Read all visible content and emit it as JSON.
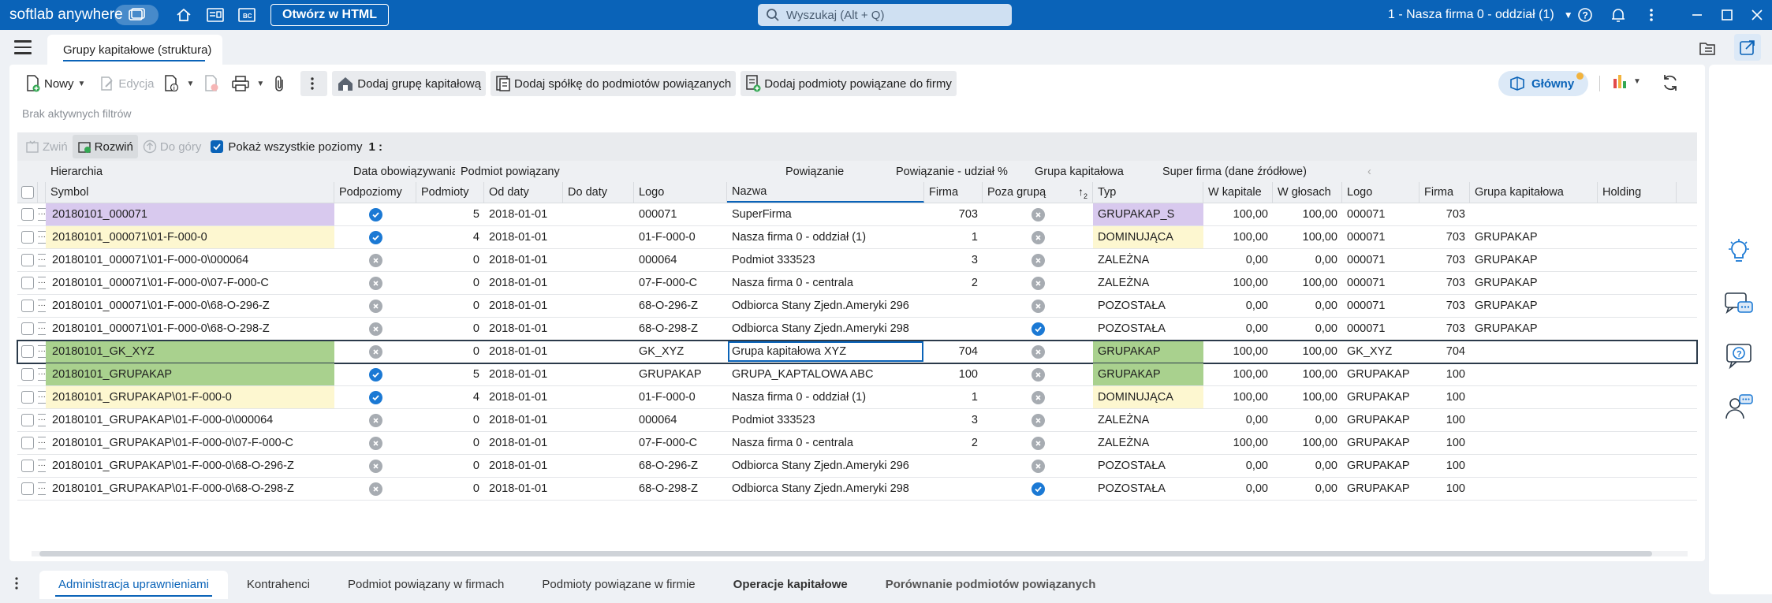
{
  "titlebar": {
    "brand": "softlab anywhere",
    "open_html": "Otwórz w HTML",
    "search_placeholder": "Wyszukaj (Alt + Q)",
    "company": "1 - Nasza firma 0 - oddział (1)"
  },
  "tab": {
    "title": "Grupy kapitałowe (struktura)"
  },
  "toolbar": {
    "new": "Nowy",
    "edit": "Edycja",
    "add_group": "Dodaj grupę kapitałową",
    "add_company": "Dodaj spółkę do podmiotów powiązanych",
    "add_related": "Dodaj podmioty powiązane do firmy",
    "view": "Główny"
  },
  "filters": "Brak aktywnych filtrów",
  "subtoolbar": {
    "collapse": "Zwiń",
    "expand": "Rozwiń",
    "up": "Do góry",
    "show_all": "Pokaż wszystkie poziomy",
    "level": "1 :"
  },
  "grid": {
    "groups": {
      "hierarchy": "Hierarchia",
      "validity": "Data obowiązywania",
      "related": "Podmiot powiązany",
      "link": "Powiązanie",
      "share": "Powiązanie - udział %",
      "capital_group": "Grupa kapitałowa",
      "super": "Super firma (dane źródłowe)"
    },
    "columns": {
      "symbol": "Symbol",
      "sublevels": "Podpoziomy",
      "entities": "Podmioty",
      "from": "Od daty",
      "to": "Do daty",
      "logo": "Logo",
      "name": "Nazwa",
      "firm": "Firma",
      "outside": "Poza grupą",
      "type": "Typ",
      "capital": "W kapitale",
      "votes": "W głosach",
      "g_logo": "Logo",
      "g_firm": "Firma",
      "s_group": "Grupa kapitałowa",
      "s_holding": "Holding"
    },
    "rows": [
      {
        "symbol": "20180101_000071",
        "sub": "ok",
        "ent": "5",
        "from": "2018-01-01",
        "logo": "000071",
        "name": "SuperFirma",
        "firm": "703",
        "out": "x",
        "type": "GRUPAKAP_S",
        "cap": "100,00",
        "votes": "100,00",
        "glogo": "000071",
        "gfirm": "703",
        "sgroup": "",
        "sym_color": "#d8c9ee",
        "type_color": "#d8c9ee"
      },
      {
        "symbol": "20180101_000071\\01-F-000-0",
        "sub": "ok",
        "ent": "4",
        "from": "2018-01-01",
        "logo": "01-F-000-0",
        "name": "Nasza firma 0 - oddział (1)",
        "firm": "1",
        "out": "x",
        "type": "DOMINUJĄCA",
        "cap": "100,00",
        "votes": "100,00",
        "glogo": "000071",
        "gfirm": "703",
        "sgroup": "GRUPAKAP",
        "sym_color": "#fdf7d0",
        "type_color": "#fdf7d0"
      },
      {
        "symbol": "20180101_000071\\01-F-000-0\\000064",
        "sub": "x",
        "ent": "0",
        "from": "2018-01-01",
        "logo": "000064",
        "name": "Podmiot 333523",
        "firm": "3",
        "out": "x",
        "type": "ZALEŻNA",
        "cap": "0,00",
        "votes": "0,00",
        "glogo": "000071",
        "gfirm": "703",
        "sgroup": "GRUPAKAP",
        "sym_color": "",
        "type_color": ""
      },
      {
        "symbol": "20180101_000071\\01-F-000-0\\07-F-000-C",
        "sub": "x",
        "ent": "0",
        "from": "2018-01-01",
        "logo": "07-F-000-C",
        "name": "Nasza firma 0 - centrala",
        "firm": "2",
        "out": "x",
        "type": "ZALEŻNA",
        "cap": "100,00",
        "votes": "100,00",
        "glogo": "000071",
        "gfirm": "703",
        "sgroup": "GRUPAKAP",
        "sym_color": "",
        "type_color": ""
      },
      {
        "symbol": "20180101_000071\\01-F-000-0\\68-O-296-Z",
        "sub": "x",
        "ent": "0",
        "from": "2018-01-01",
        "logo": "68-O-296-Z",
        "name": "Odbiorca Stany Zjedn.Ameryki 296",
        "firm": "",
        "out": "x",
        "type": "POZOSTAŁA",
        "cap": "0,00",
        "votes": "0,00",
        "glogo": "000071",
        "gfirm": "703",
        "sgroup": "GRUPAKAP",
        "sym_color": "",
        "type_color": ""
      },
      {
        "symbol": "20180101_000071\\01-F-000-0\\68-O-298-Z",
        "sub": "x",
        "ent": "0",
        "from": "2018-01-01",
        "logo": "68-O-298-Z",
        "name": "Odbiorca Stany Zjedn.Ameryki 298",
        "firm": "",
        "out": "ok",
        "type": "POZOSTAŁA",
        "cap": "0,00",
        "votes": "0,00",
        "glogo": "000071",
        "gfirm": "703",
        "sgroup": "GRUPAKAP",
        "sym_color": "",
        "type_color": ""
      },
      {
        "symbol": "20180101_GK_XYZ",
        "sub": "x",
        "ent": "0",
        "from": "2018-01-01",
        "logo": "GK_XYZ",
        "name": "Grupa kapitałowa XYZ",
        "firm": "704",
        "out": "x",
        "type": "GRUPAKAP",
        "cap": "100,00",
        "votes": "100,00",
        "glogo": "GK_XYZ",
        "gfirm": "704",
        "sgroup": "",
        "sym_color": "#a9d18e",
        "type_color": "#a9d18e",
        "selected": true
      },
      {
        "symbol": "20180101_GRUPAKAP",
        "sub": "ok",
        "ent": "5",
        "from": "2018-01-01",
        "logo": "GRUPAKAP",
        "name": "GRUPA_KAPTALOWA ABC",
        "firm": "100",
        "out": "x",
        "type": "GRUPAKAP",
        "cap": "100,00",
        "votes": "100,00",
        "glogo": "GRUPAKAP",
        "gfirm": "100",
        "sgroup": "",
        "sym_color": "#a9d18e",
        "type_color": "#a9d18e"
      },
      {
        "symbol": "20180101_GRUPAKAP\\01-F-000-0",
        "sub": "ok",
        "ent": "4",
        "from": "2018-01-01",
        "logo": "01-F-000-0",
        "name": "Nasza firma 0 - oddział (1)",
        "firm": "1",
        "out": "x",
        "type": "DOMINUJĄCA",
        "cap": "100,00",
        "votes": "100,00",
        "glogo": "GRUPAKAP",
        "gfirm": "100",
        "sgroup": "",
        "sym_color": "#fdf7d0",
        "type_color": "#fdf7d0"
      },
      {
        "symbol": "20180101_GRUPAKAP\\01-F-000-0\\000064",
        "sub": "x",
        "ent": "0",
        "from": "2018-01-01",
        "logo": "000064",
        "name": "Podmiot 333523",
        "firm": "3",
        "out": "x",
        "type": "ZALEŻNA",
        "cap": "0,00",
        "votes": "0,00",
        "glogo": "GRUPAKAP",
        "gfirm": "100",
        "sgroup": "",
        "sym_color": "",
        "type_color": ""
      },
      {
        "symbol": "20180101_GRUPAKAP\\01-F-000-0\\07-F-000-C",
        "sub": "x",
        "ent": "0",
        "from": "2018-01-01",
        "logo": "07-F-000-C",
        "name": "Nasza firma 0 - centrala",
        "firm": "2",
        "out": "x",
        "type": "ZALEŻNA",
        "cap": "100,00",
        "votes": "100,00",
        "glogo": "GRUPAKAP",
        "gfirm": "100",
        "sgroup": "",
        "sym_color": "",
        "type_color": ""
      },
      {
        "symbol": "20180101_GRUPAKAP\\01-F-000-0\\68-O-296-Z",
        "sub": "x",
        "ent": "0",
        "from": "2018-01-01",
        "logo": "68-O-296-Z",
        "name": "Odbiorca Stany Zjedn.Ameryki 296",
        "firm": "",
        "out": "x",
        "type": "POZOSTAŁA",
        "cap": "0,00",
        "votes": "0,00",
        "glogo": "GRUPAKAP",
        "gfirm": "100",
        "sgroup": "",
        "sym_color": "",
        "type_color": ""
      },
      {
        "symbol": "20180101_GRUPAKAP\\01-F-000-0\\68-O-298-Z",
        "sub": "x",
        "ent": "0",
        "from": "2018-01-01",
        "logo": "68-O-298-Z",
        "name": "Odbiorca Stany Zjedn.Ameryki 298",
        "firm": "",
        "out": "ok",
        "type": "POZOSTAŁA",
        "cap": "0,00",
        "votes": "0,00",
        "glogo": "GRUPAKAP",
        "gfirm": "100",
        "sgroup": "",
        "sym_color": "",
        "type_color": ""
      }
    ]
  },
  "bottom_tabs": [
    "Administracja uprawnieniami",
    "Kontrahenci",
    "Podmiot powiązany w firmach",
    "Podmioty powiązane w firmie",
    "Operacje kapitałowe",
    "Porównanie podmiotów powiązanych"
  ],
  "colors": {
    "accent": "#0a63b8",
    "purple": "#d8c9ee",
    "yellow": "#fdf7d0",
    "green": "#a9d18e"
  },
  "icons": [
    "home-icon",
    "document-icon",
    "bc-icon",
    "search-icon",
    "help-icon",
    "bell-icon",
    "more-icon",
    "minimize-icon",
    "maximize-icon",
    "close-icon",
    "hamburger-icon",
    "folder-list-icon",
    "share-icon",
    "lightbulb-icon",
    "chat-icon",
    "help-chat-icon",
    "support-icon"
  ]
}
